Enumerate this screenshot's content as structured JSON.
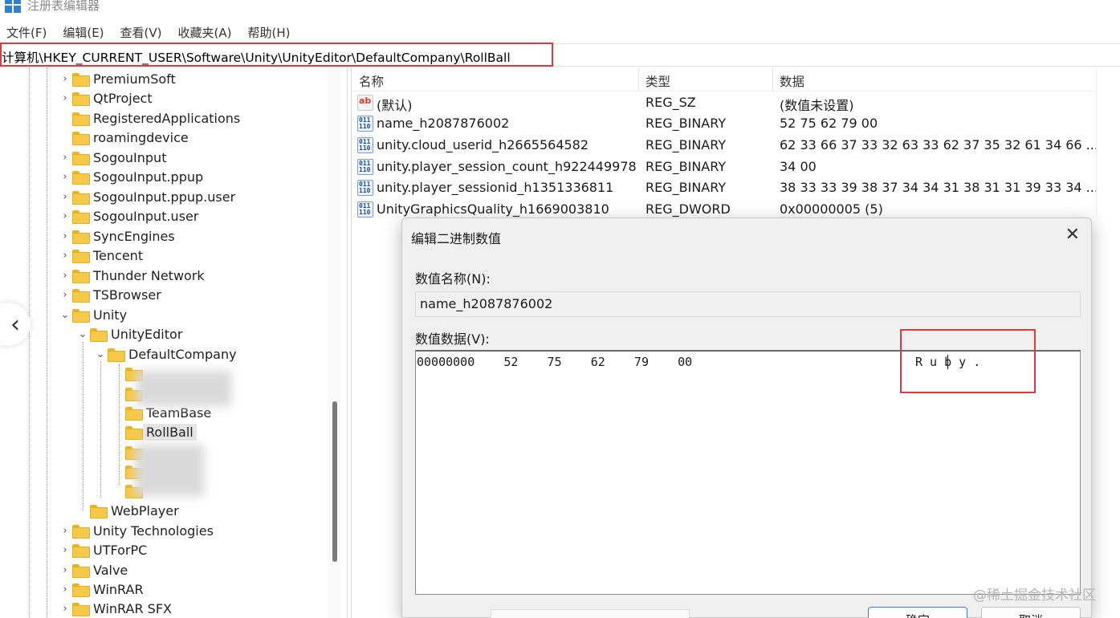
{
  "window": {
    "title": "注册表编辑器"
  },
  "menu": [
    "文件(F)",
    "编辑(E)",
    "查看(V)",
    "收藏夹(A)",
    "帮助(H)"
  ],
  "address": "计算机\\HKEY_CURRENT_USER\\Software\\Unity\\UnityEditor\\DefaultCompany\\RollBall",
  "tree": {
    "items": [
      {
        "label": "PremiumSoft",
        "expander": ">"
      },
      {
        "label": "QtProject",
        "expander": ">"
      },
      {
        "label": "RegisteredApplications",
        "expander": ""
      },
      {
        "label": "roamingdevice",
        "expander": ""
      },
      {
        "label": "SogouInput",
        "expander": ">"
      },
      {
        "label": "SogouInput.ppup",
        "expander": ">"
      },
      {
        "label": "SogouInput.ppup.user",
        "expander": ">"
      },
      {
        "label": "SogouInput.user",
        "expander": ">"
      },
      {
        "label": "SyncEngines",
        "expander": ">"
      },
      {
        "label": "Tencent",
        "expander": ">"
      },
      {
        "label": "Thunder Network",
        "expander": ">"
      },
      {
        "label": "TSBrowser",
        "expander": ">"
      },
      {
        "label": "Unity",
        "expander": "v"
      },
      {
        "label": "UnityEditor",
        "expander": "v"
      },
      {
        "label": "DefaultCompany",
        "expander": "v"
      },
      {
        "label": "TeamBase",
        "expander": ""
      },
      {
        "label": "RollBall",
        "expander": ""
      },
      {
        "label": "WebPlayer",
        "expander": ""
      },
      {
        "label": "Unity Technologies",
        "expander": ">"
      },
      {
        "label": "UTForPC",
        "expander": ">"
      },
      {
        "label": "Valve",
        "expander": ">"
      },
      {
        "label": "WinRAR",
        "expander": ">"
      },
      {
        "label": "WinRAR SFX",
        "expander": ">"
      }
    ],
    "selected": "RollBall"
  },
  "values": {
    "headers": {
      "name": "名称",
      "type": "类型",
      "data": "数据"
    },
    "rows": [
      {
        "name": "(默认)",
        "type": "REG_SZ",
        "data": "(数值未设置)",
        "icon": "string-value-icon"
      },
      {
        "name": "name_h2087876002",
        "type": "REG_BINARY",
        "data": "52 75 62 79 00",
        "icon": "binary-value-icon"
      },
      {
        "name": "unity.cloud_userid_h2665564582",
        "type": "REG_BINARY",
        "data": "62 33 66 37 33 32 63 33 62 37 35 32 61 34 66 ...",
        "icon": "binary-value-icon"
      },
      {
        "name": "unity.player_session_count_h922449978",
        "type": "REG_BINARY",
        "data": "34 00",
        "icon": "binary-value-icon"
      },
      {
        "name": "unity.player_sessionid_h1351336811",
        "type": "REG_BINARY",
        "data": "38 33 33 39 38 37 34 34 31 38 31 31 39 33 34 ...",
        "icon": "binary-value-icon"
      },
      {
        "name": "UnityGraphicsQuality_h1669003810",
        "type": "REG_DWORD",
        "data": "0x00000005 (5)",
        "icon": "binary-value-icon"
      }
    ]
  },
  "dialog": {
    "title": "编辑二进制数值",
    "name_label": "数值名称(N):",
    "name_value": "name_h2087876002",
    "data_label": "数值数据(V):",
    "hex_line": "00000000    52    75    62    79    00",
    "ascii": "R u b y .",
    "ok": "确定",
    "cancel": "取消"
  },
  "watermark": "@稀土掘金技术社区",
  "colors": {
    "highlight": "#e0393d",
    "folder": "#f7c948"
  }
}
